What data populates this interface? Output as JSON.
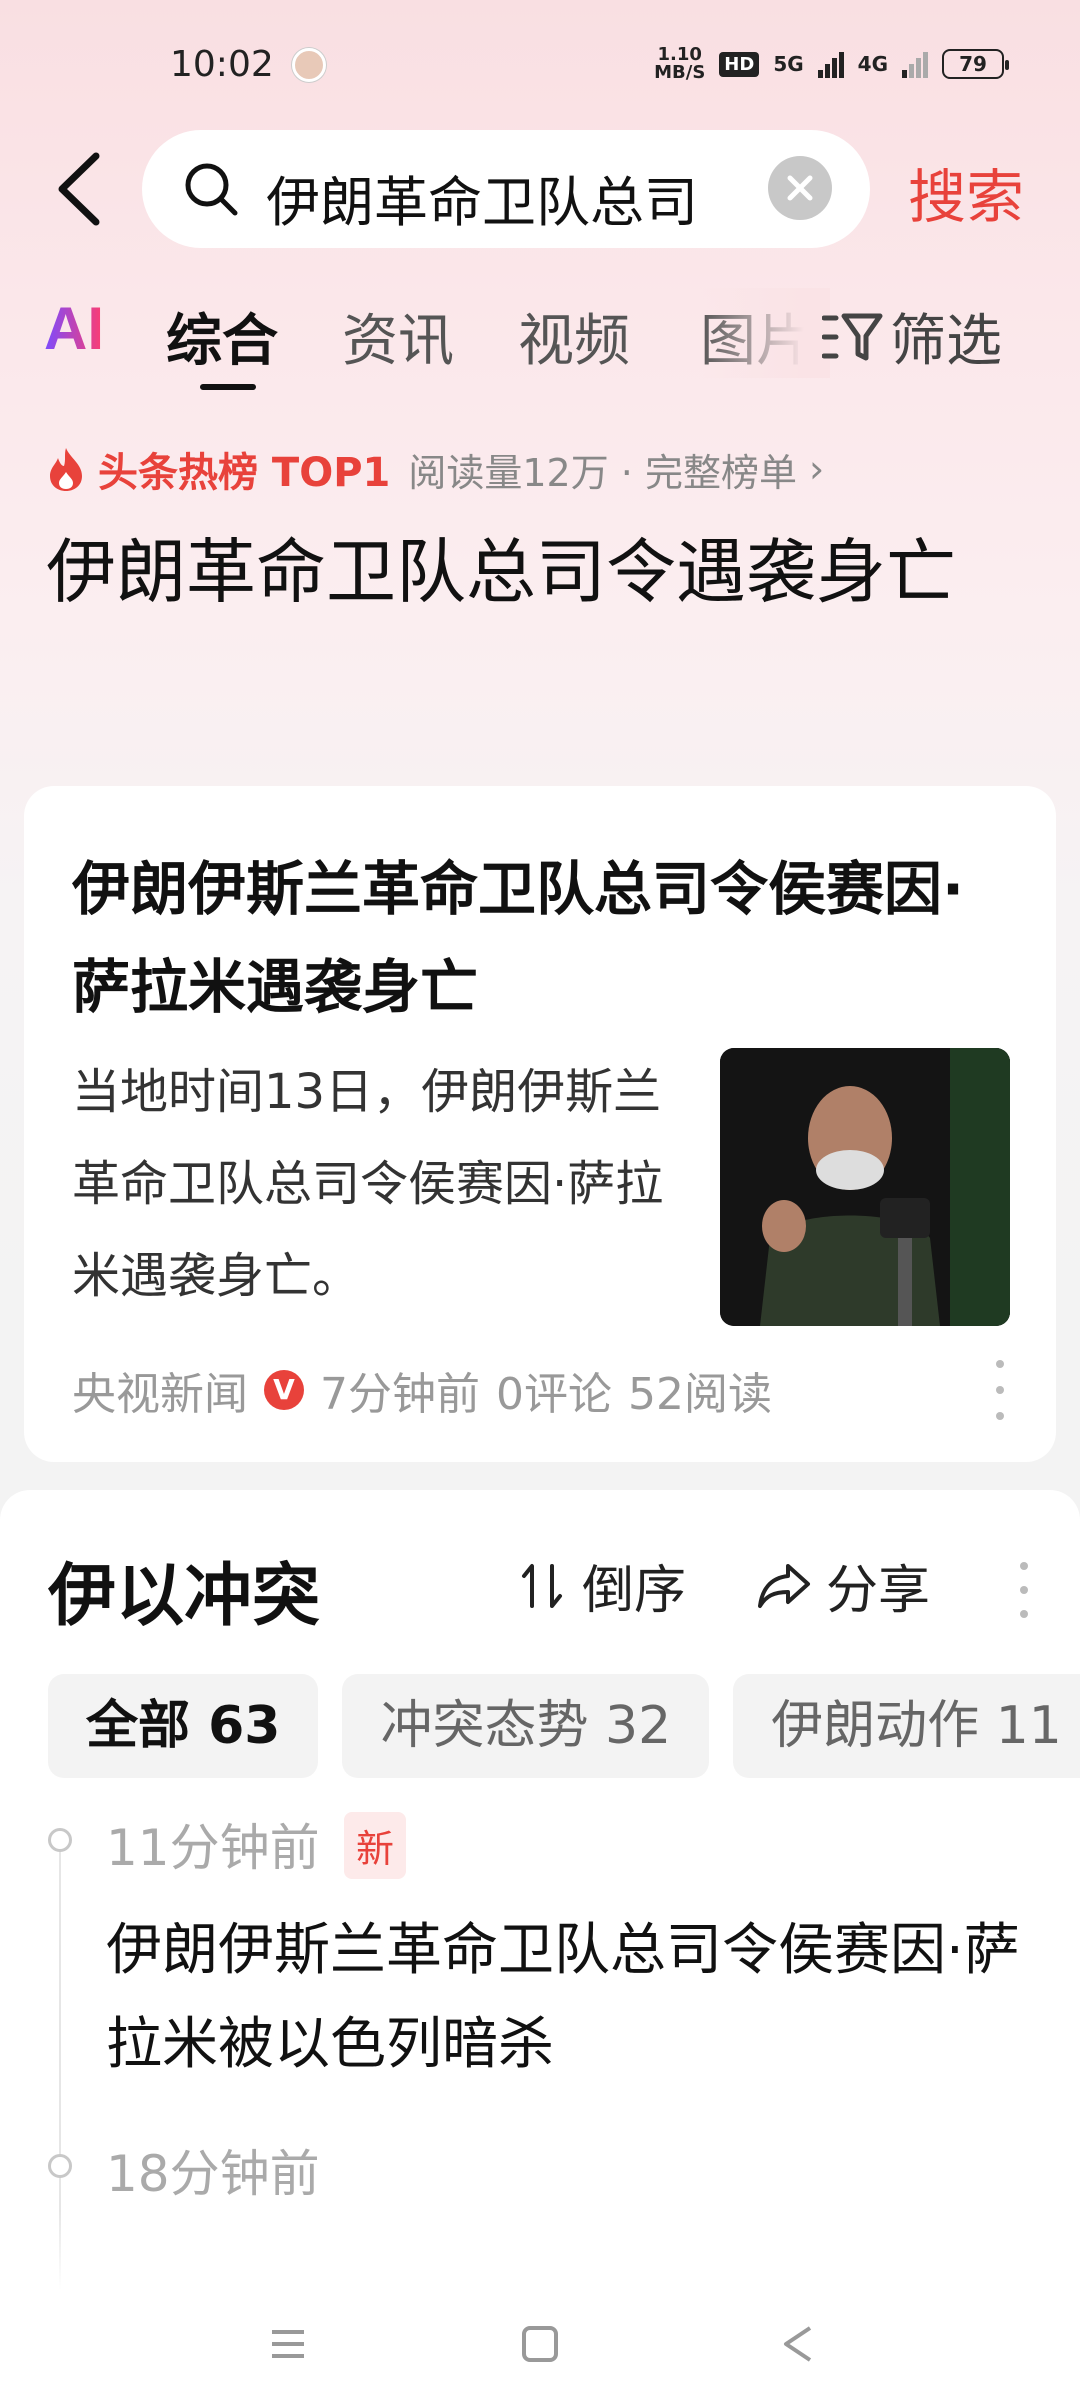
{
  "status_bar": {
    "time": "10:02",
    "net_speed_value": "1.10",
    "net_speed_unit": "MB/S",
    "hd": "HD",
    "signal_5g": "5G",
    "signal_4g": "4G",
    "battery": "79"
  },
  "search": {
    "query": "伊朗革命卫队总司",
    "submit_label": "搜索"
  },
  "tabs": {
    "ai_label": "AI",
    "items": [
      "综合",
      "资讯",
      "视频",
      "图片"
    ],
    "active_index": 0,
    "filter_label": "筛选"
  },
  "hot": {
    "badge": "头条热榜 TOP1",
    "meta": "阅读量12万 · 完整榜单",
    "chevron": "›",
    "title": "伊朗革命卫队总司令遇袭身亡"
  },
  "news": {
    "title": "伊朗伊斯兰革命卫队总司令侯赛因·萨拉米遇袭身亡",
    "summary": "当地时间13日，伊朗伊斯兰革命卫队总司令侯赛因·萨拉米遇袭身亡。",
    "source": "央视新闻",
    "verified_mark": "V",
    "time": "7分钟前",
    "comments": "0评论",
    "reads": "52阅读"
  },
  "topic": {
    "title": "伊以冲突",
    "sort_label": "倒序",
    "share_label": "分享",
    "chips": [
      "全部 63",
      "冲突态势 32",
      "伊朗动作 11"
    ],
    "timeline": [
      {
        "time": "11分钟前",
        "badge": "新",
        "text": "伊朗伊斯兰革命卫队总司令侯赛因·萨拉米被以色列暗杀"
      },
      {
        "time": "18分钟前",
        "badge": "",
        "text": ""
      }
    ]
  },
  "colors": {
    "accent": "#e8423b",
    "background_top": "#f9dfe2"
  }
}
